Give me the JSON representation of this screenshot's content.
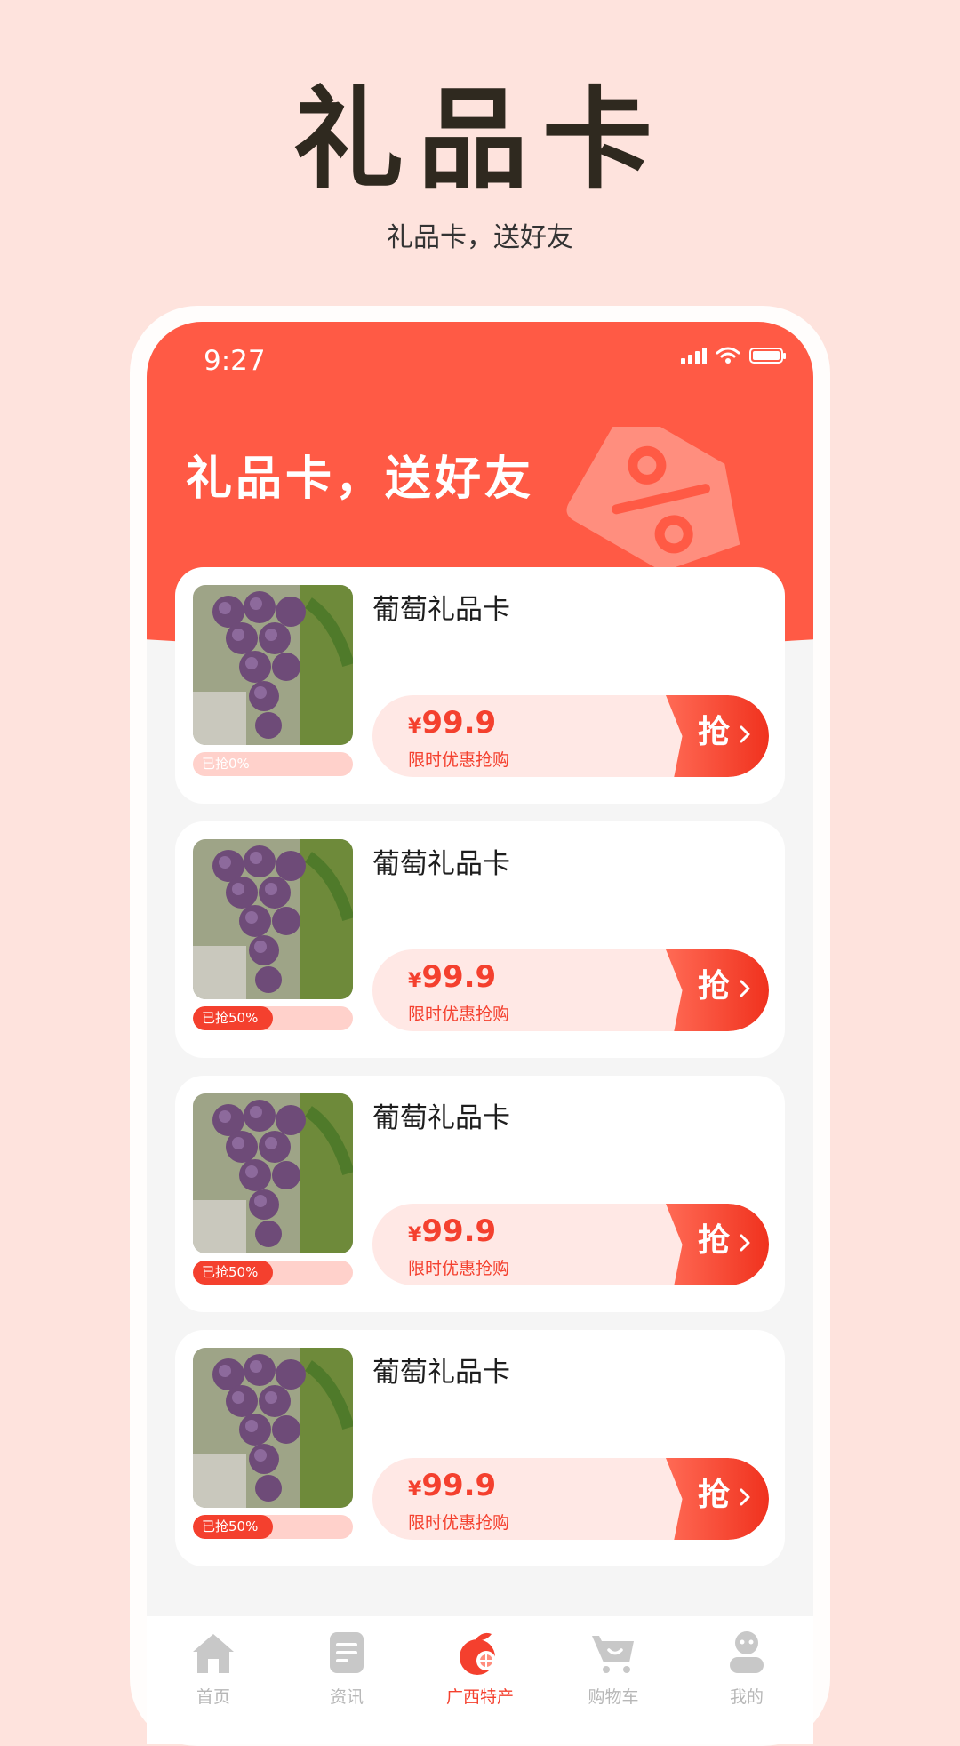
{
  "hero": {
    "title": "礼品卡",
    "subtitle": "礼品卡，送好友"
  },
  "status_bar": {
    "time": "9:27"
  },
  "banner": {
    "title": "礼品卡，送好友"
  },
  "colors": {
    "accent": "#F4402E",
    "header": "#FF5A45",
    "background": "#FEE3DD"
  },
  "cards": [
    {
      "name": "葡萄礼品卡",
      "currency": "¥",
      "price": "99.9",
      "promo": "限时优惠抢购",
      "progress_label": "已抢0%",
      "progress": 0,
      "button": "抢"
    },
    {
      "name": "葡萄礼品卡",
      "currency": "¥",
      "price": "99.9",
      "promo": "限时优惠抢购",
      "progress_label": "已抢50%",
      "progress": 0.5,
      "button": "抢"
    },
    {
      "name": "葡萄礼品卡",
      "currency": "¥",
      "price": "99.9",
      "promo": "限时优惠抢购",
      "progress_label": "已抢50%",
      "progress": 0.5,
      "button": "抢"
    },
    {
      "name": "葡萄礼品卡",
      "currency": "¥",
      "price": "99.9",
      "promo": "限时优惠抢购",
      "progress_label": "已抢50%",
      "progress": 0.5,
      "button": "抢"
    }
  ],
  "tabbar": {
    "items": [
      {
        "label": "首页",
        "icon": "home-icon",
        "active": false
      },
      {
        "label": "资讯",
        "icon": "news-icon",
        "active": false
      },
      {
        "label": "广西特产",
        "icon": "fruit-icon",
        "active": true
      },
      {
        "label": "购物车",
        "icon": "cart-icon",
        "active": false
      },
      {
        "label": "我的",
        "icon": "profile-icon",
        "active": false
      }
    ]
  }
}
